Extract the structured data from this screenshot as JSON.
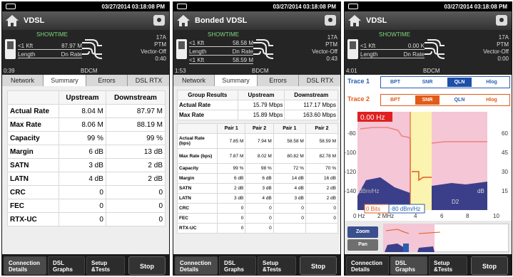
{
  "datetime": "03/27/2014 03:18:08 PM",
  "panels": [
    {
      "title": "VDSL",
      "status": "SHOWTIME",
      "info_rows": [
        [
          "<1 Kft",
          "87.97 M"
        ],
        [
          "Length",
          "Dn Rate"
        ]
      ],
      "right_lines": [
        "17A",
        "PTM",
        "Vector-Off",
        "0:40"
      ],
      "time": "0:39",
      "bdcm": "BDCM"
    },
    {
      "title": "Bonded VDSL",
      "status": "SHOWTIME",
      "info_rows": [
        [
          "<1 Kft",
          "58.58 M"
        ],
        [
          "Length",
          "Dn Rate"
        ],
        [
          "<1 Kft",
          "58.59 M"
        ]
      ],
      "right_lines": [
        "17A",
        "PTM",
        "Vector-Off",
        "0:43"
      ],
      "time": "1:53",
      "bdcm": "BDCM"
    },
    {
      "title": "VDSL",
      "status": "SHOWTIME",
      "info_rows": [
        [
          "<1 Kft",
          "0.00 K"
        ],
        [
          "Length",
          "Dn Rate"
        ]
      ],
      "right_lines": [
        "17A",
        "PTM",
        "Vector-Off",
        "0:00"
      ],
      "time": "4:01",
      "bdcm": "BDCM"
    }
  ],
  "tabs": [
    "Network",
    "Summary",
    "Errors",
    "DSL RTX"
  ],
  "bottom": {
    "connection": [
      "Connection",
      "Details"
    ],
    "graphs": [
      "DSL",
      "Graphs"
    ],
    "setup": [
      "Setup",
      "&Tests"
    ],
    "stop": "Stop"
  },
  "summary": {
    "headers": [
      "",
      "Upstream",
      "Downstream"
    ],
    "rows": [
      [
        "Actual Rate",
        "8.04 M",
        "87.97 M"
      ],
      [
        "Max Rate",
        "8.06 M",
        "88.19 M"
      ],
      [
        "Capacity",
        "99 %",
        "99 %"
      ],
      [
        "Margin",
        "6 dB",
        "13 dB"
      ],
      [
        "SATN",
        "3 dB",
        "2 dB"
      ],
      [
        "LATN",
        "4 dB",
        "2 dB"
      ],
      [
        "CRC",
        "0",
        "0"
      ],
      [
        "FEC",
        "0",
        "0"
      ],
      [
        "RTX-UC",
        "0",
        "0"
      ]
    ]
  },
  "bonded": {
    "group_headers": [
      "Group Results",
      "Upstream",
      "Downstream"
    ],
    "group_rows": [
      [
        "Actual Rate",
        "15.79 Mbps",
        "117.17 Mbps"
      ],
      [
        "Max Rate",
        "15.89 Mbps",
        "163.60 Mbps"
      ]
    ],
    "pair_headers": [
      "",
      "Pair 1",
      "Pair 2",
      "Pair 1",
      "Pair 2"
    ],
    "pair_rows": [
      [
        "Actual Rate (bps)",
        "7.85 M",
        "7.94 M",
        "58.58 M",
        "58.59 M"
      ],
      [
        "Max Rate (bps)",
        "7.87 M",
        "8.02 M",
        "80.82 M",
        "82.78 M"
      ],
      [
        "Capacity",
        "99 %",
        "98 %",
        "72 %",
        "70 %"
      ],
      [
        "Margin",
        "6 dB",
        "6 dB",
        "14 dB",
        "16 dB"
      ],
      [
        "SATN",
        "2 dB",
        "3 dB",
        "4 dB",
        "2 dB"
      ],
      [
        "LATN",
        "3 dB",
        "4 dB",
        "3 dB",
        "2 dB"
      ],
      [
        "CRC",
        "0",
        "0",
        "0",
        "0"
      ],
      [
        "FEC",
        "0",
        "0",
        "0",
        "0"
      ],
      [
        "RTX-UC",
        "0",
        "0",
        "",
        ""
      ]
    ]
  },
  "qln": {
    "trace1": "Trace 1",
    "trace2": "Trace 2",
    "buttons": [
      "BPT",
      "SNR",
      "QLN",
      "Hlog"
    ],
    "freq_marker": "0.00 Hz",
    "left_axis": [
      "-80",
      "-100",
      "-120",
      "-140"
    ],
    "right_axis": [
      "60",
      "45",
      "30",
      "15"
    ],
    "x_axis": [
      "0 Hz",
      "2 MHz",
      "4",
      "6",
      "8",
      "10"
    ],
    "unit_left": "dBm/Hz",
    "unit_right": "dB",
    "cursor_label": "0 Bits",
    "cursor_value": "-80 dBm/Hz",
    "band_label": "D2",
    "zoom": "Zoom",
    "pan": "Pan",
    "colors": {
      "trace1": "#2a5db0",
      "trace2": "#e05a1a",
      "selected": "#1d4fa8"
    }
  }
}
